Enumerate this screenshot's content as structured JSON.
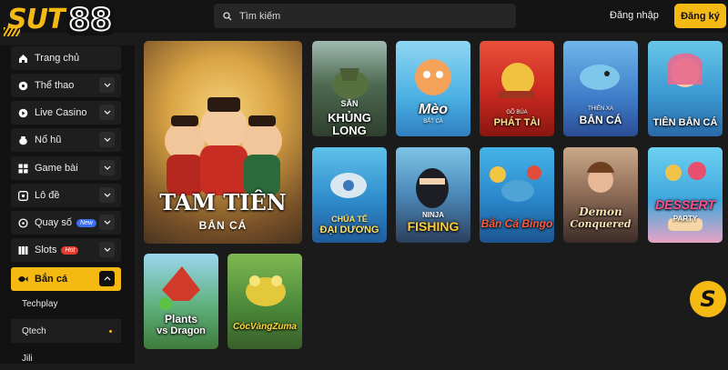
{
  "brand": {
    "logo_text": "SUT",
    "logo_number": "88"
  },
  "search": {
    "placeholder": "Tìm kiếm"
  },
  "auth": {
    "login_label": "Đăng nhập",
    "register_label": "Đăng ký"
  },
  "sidebar": {
    "items": [
      {
        "label": "Trang chủ",
        "icon": "home-icon"
      },
      {
        "label": "Thể thao",
        "icon": "ball-icon"
      },
      {
        "label": "Live Casino",
        "icon": "play-icon"
      },
      {
        "label": "Nổ hũ",
        "icon": "pot-icon"
      },
      {
        "label": "Game bài",
        "icon": "cards-icon"
      },
      {
        "label": "Lô đề",
        "icon": "lottery-icon"
      },
      {
        "label": "Quay số",
        "icon": "spin-icon",
        "badge": "New"
      },
      {
        "label": "Slots",
        "icon": "slots-icon",
        "badge": "Hot"
      },
      {
        "label": "Bắn cá",
        "icon": "fish-icon"
      }
    ],
    "sub_items": [
      {
        "label": "Techplay"
      },
      {
        "label": "Qtech"
      },
      {
        "label": "Jili"
      }
    ]
  },
  "games": [
    {
      "title": "TAM TIÊN",
      "subtitle": "BẮN CÁ"
    },
    {
      "title": "SĂN",
      "subtitle": "KHỦNG LONG"
    },
    {
      "title": "Mèo",
      "subtitle": "BẮT CÁ"
    },
    {
      "title": "GÕ BÚA",
      "subtitle": "PHÁT TÀI"
    },
    {
      "title": "THIÊN XA",
      "subtitle": "BẮN CÁ"
    },
    {
      "title": "TIÊN BẮN CÁ",
      "subtitle": ""
    },
    {
      "title": "CHÚA TỂ",
      "subtitle": "ĐẠI DƯƠNG"
    },
    {
      "title": "NINJA",
      "subtitle": "FISHING"
    },
    {
      "title": "Bắn Cá Bingo",
      "subtitle": ""
    },
    {
      "title": "Demon",
      "subtitle": "Conquered"
    },
    {
      "title": "DESSERT",
      "subtitle": "PARTY"
    },
    {
      "title": "Plants",
      "subtitle": "vs Dragon"
    },
    {
      "title": "CócVàngZuma",
      "subtitle": ""
    }
  ],
  "fab": {
    "label": "S"
  },
  "colors": {
    "accent": "#f5b914",
    "background": "#1b1b1b",
    "sidebar": "#121212"
  }
}
